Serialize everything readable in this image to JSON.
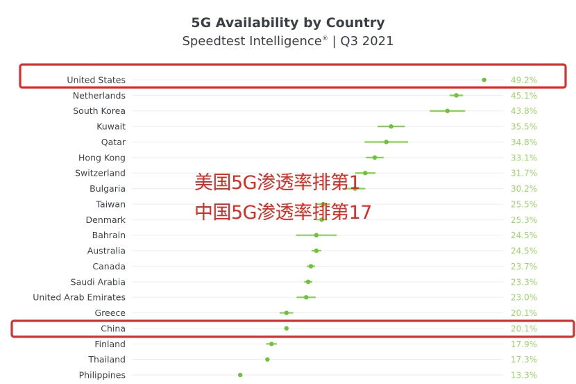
{
  "chart_data": {
    "type": "scatter",
    "title": "5G Availability by Country",
    "subtitle": "Speedtest Intelligence",
    "subtitle_mark": "®",
    "subtitle_period": "| Q3 2021",
    "xlabel": "",
    "ylabel": "",
    "xlim": [
      0,
      50
    ],
    "grid": true,
    "legend": "none",
    "unit": "%",
    "categories": [
      "United States",
      "Netherlands",
      "South Korea",
      "Kuwait",
      "Qatar",
      "Hong Kong",
      "Switzerland",
      "Bulgaria",
      "Taiwan",
      "Denmark",
      "Bahrain",
      "Australia",
      "Canada",
      "Saudi Arabia",
      "United Arab Emirates",
      "Greece",
      "China",
      "Finland",
      "Thailand",
      "Philippines"
    ],
    "values": [
      49.2,
      45.1,
      43.8,
      35.5,
      34.8,
      33.1,
      31.7,
      30.2,
      25.5,
      25.3,
      24.5,
      24.5,
      23.7,
      23.3,
      23.0,
      20.1,
      20.1,
      17.9,
      17.3,
      13.3
    ],
    "value_labels": [
      "49.2%",
      "45.1%",
      "43.8%",
      "35.5%",
      "34.8%",
      "33.1%",
      "31.7%",
      "30.2%",
      "25.5%",
      "25.3%",
      "24.5%",
      "24.5%",
      "23.7%",
      "23.3%",
      "23.0%",
      "20.1%",
      "20.1%",
      "17.9%",
      "17.3%",
      "13.3%"
    ],
    "error_margins": [
      0.0,
      1.0,
      2.6,
      2.0,
      3.2,
      1.3,
      1.5,
      1.5,
      1.0,
      0.8,
      3.0,
      0.7,
      0.6,
      0.6,
      1.4,
      1.0,
      0.0,
      0.8,
      0.0,
      0.0
    ],
    "highlighted": [
      "United States",
      "China"
    ]
  },
  "annotations": {
    "line1": "美国5G渗透率排第1",
    "line2": "中国5G渗透率排第17"
  },
  "colors": {
    "dot": "#6cc23a",
    "ci": "#86d04f",
    "value_text": "#9bd66a",
    "highlight": "#d8302a",
    "annotation": "#d92b22"
  }
}
